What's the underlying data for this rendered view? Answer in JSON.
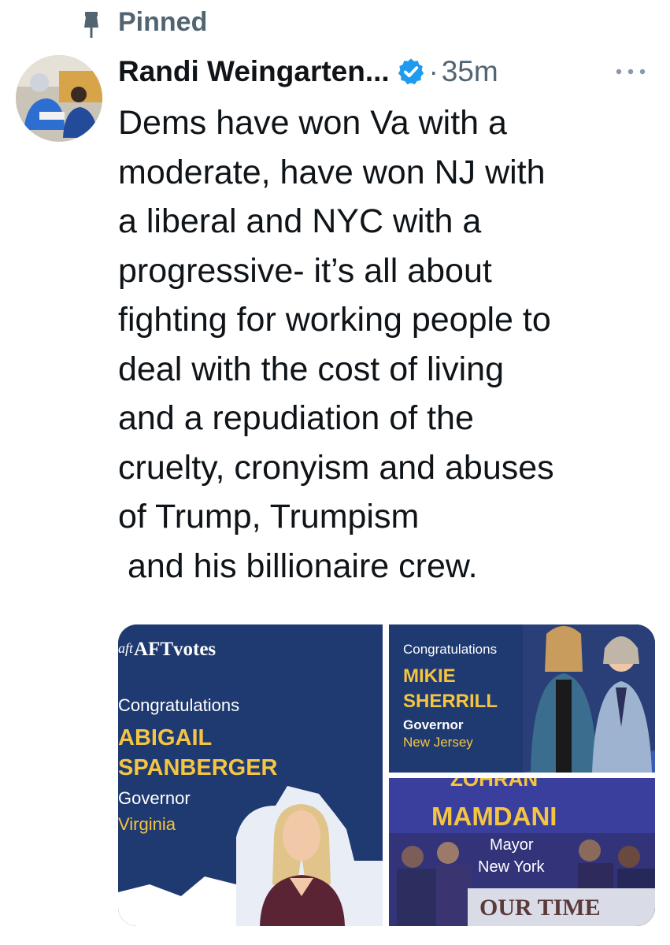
{
  "pinned": {
    "label": "Pinned",
    "icon": "pin-icon"
  },
  "author": {
    "display_name": "Randi Weingarten...",
    "verified_icon": "verified-badge-icon",
    "separator": "·",
    "timestamp": "35m"
  },
  "tweet": {
    "text": "Dems have won Va with a\nmoderate, have won NJ with\na liberal and NYC with a\nprogressive- it’s all about\nfighting for working people to\ndeal with the cost of living\nand a repudiation of the\ncruelty, cronyism and abuses\nof Trump, Trumpism\n and his billionaire crew."
  },
  "media": {
    "left": {
      "brand": "AFTvotes",
      "brand_mark": "aft",
      "congrats": "Congratulations",
      "name_line1": "ABIGAIL",
      "name_line2": "SPANBERGER",
      "role": "Governor",
      "place": "Virginia"
    },
    "top_right": {
      "congrats": "Congratulations",
      "name_line1": "MIKIE",
      "name_line2": "SHERRILL",
      "role": "Governor",
      "place": "New Jersey"
    },
    "bottom_right": {
      "name_top": "ZOHRAN",
      "name_line": "MAMDANI",
      "role": "Mayor",
      "place": "New York",
      "banner": "OUR TIME"
    }
  },
  "colors": {
    "text": "#0f1419",
    "secondary": "#536471",
    "verified": "#1d9bf0",
    "card_blue": "#1f3a70",
    "card_purple": "#3a3f9e",
    "gold": "#f5c542"
  }
}
